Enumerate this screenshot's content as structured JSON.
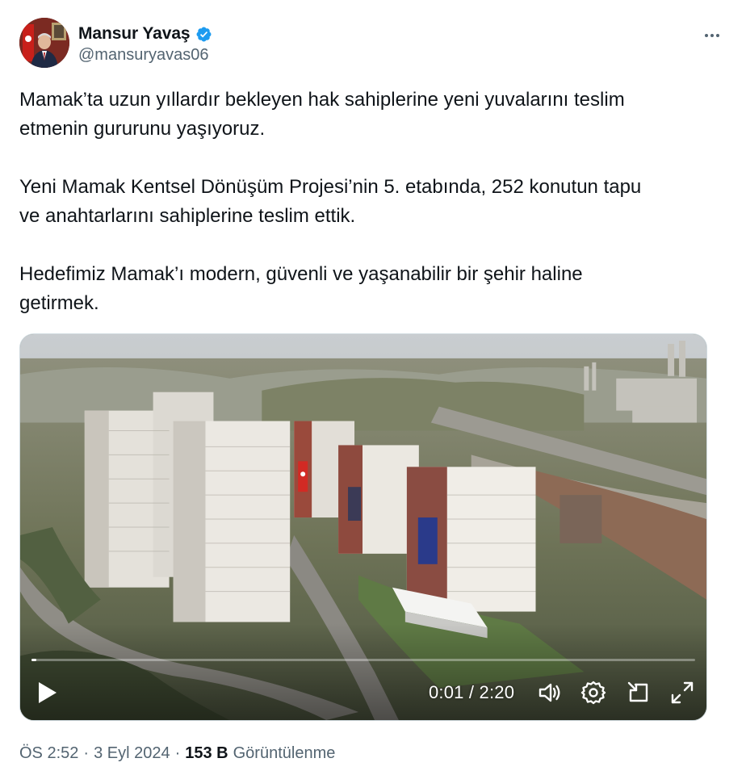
{
  "author": {
    "display_name": "Mansur Yavaş",
    "handle": "@mansuryavas06",
    "verified": true,
    "avatar_icon": "profile-photo"
  },
  "tweet": {
    "paragraphs": [
      [
        "Mamak’ta uzun yıllardır bekleyen hak sahiplerine yeni yuvalarını teslim",
        "etmenin gururunu yaşıyoruz."
      ],
      [
        "Yeni Mamak Kentsel Dönüşüm Projesi’nin 5. etabında, 252 konutun tapu",
        "ve anahtarlarını sahiplerine teslim ettik."
      ],
      [
        "Hedefimiz Mamak’ı modern, güvenli ve yaşanabilir bir şehir haline",
        "getirmek."
      ]
    ]
  },
  "video": {
    "time_display": "0:01 / 2:20",
    "progress_fraction": 0.007,
    "icons": [
      "play-icon",
      "volume-icon",
      "settings-gear-icon",
      "pip-icon",
      "fullscreen-icon"
    ]
  },
  "meta": {
    "time": "ÖS 2:52",
    "date": "3 Eyl 2024",
    "views_count": "153 B",
    "views_label": "Görüntülenme",
    "separator": "·"
  },
  "colors": {
    "text": "#0f1419",
    "secondary": "#536471",
    "verified": "#1d9bf0"
  }
}
